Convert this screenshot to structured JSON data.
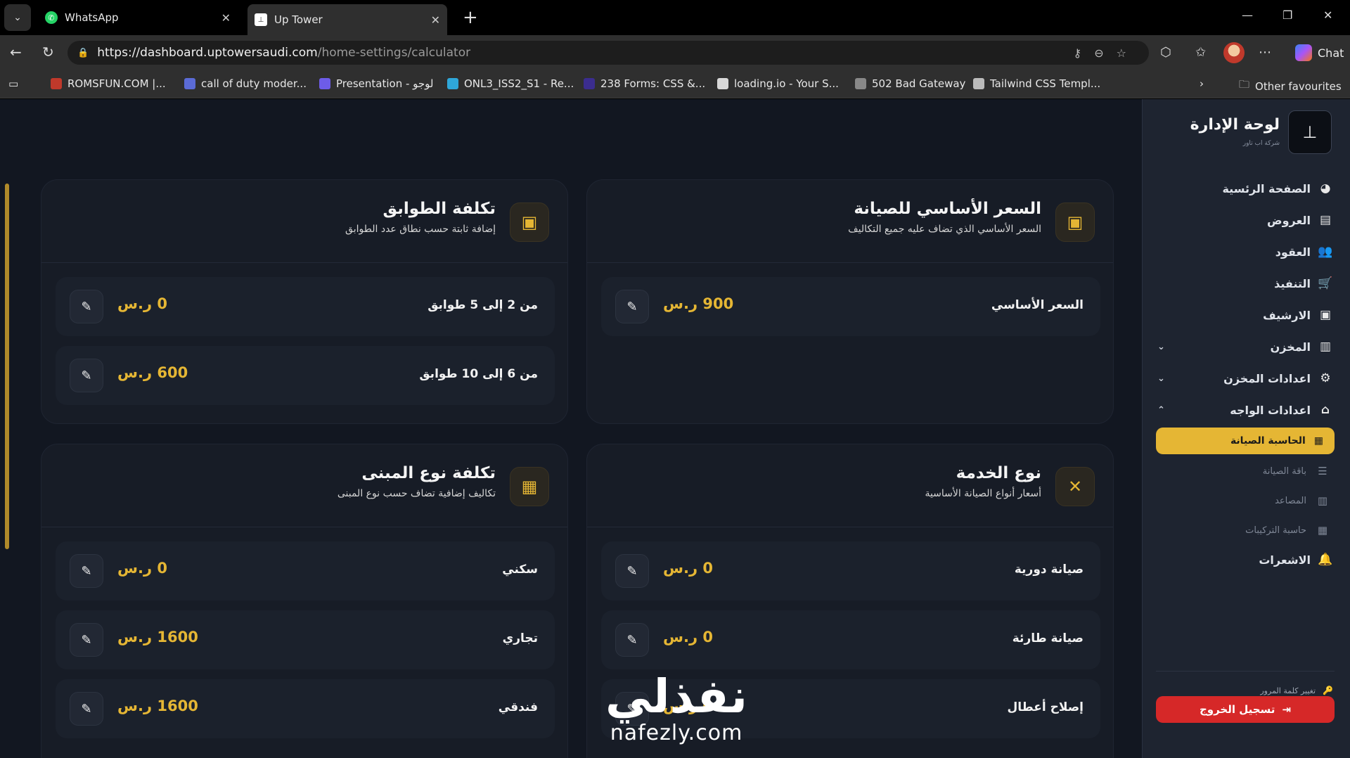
{
  "browser": {
    "tabs": [
      {
        "title": "WhatsApp",
        "icon": "whatsapp-icon"
      },
      {
        "title": "Up Tower",
        "icon": "uptower-favicon"
      }
    ],
    "url_host": "https://dashboard.uptowersaudi.com",
    "url_path": "/home-settings/calculator",
    "chat_label": "Chat",
    "bookmarks": [
      {
        "label": "ROMSFUN.COM |..."
      },
      {
        "label": "call of duty moder..."
      },
      {
        "label": "Presentation - لوجو"
      },
      {
        "label": "ONL3_ISS2_S1 - Re..."
      },
      {
        "label": "238 Forms: CSS &..."
      },
      {
        "label": "loading.io - Your S..."
      },
      {
        "label": "502 Bad Gateway"
      },
      {
        "label": "Tailwind CSS Templ..."
      }
    ],
    "other_favourites": "Other favourites"
  },
  "sidebar": {
    "brand_title": "لوحة الإدارة",
    "brand_sub": "شركة اب تاور",
    "nav": [
      {
        "label": "الصفحة الرئسية",
        "icon": "pie-chart-icon"
      },
      {
        "label": "العروض",
        "icon": "offers-icon"
      },
      {
        "label": "العقود",
        "icon": "users-icon"
      },
      {
        "label": "التنفيذ",
        "icon": "cart-icon"
      },
      {
        "label": "الارشيف",
        "icon": "archive-icon"
      },
      {
        "label": "المخزن",
        "icon": "warehouse-icon"
      },
      {
        "label": "اعدادات المخزن",
        "icon": "gear-icon"
      },
      {
        "label": "اعدادات الواجه",
        "icon": "home-icon"
      }
    ],
    "active": "الحاسبة الصيانة",
    "sub": [
      {
        "label": "باقة الصيانة",
        "icon": "list-icon"
      },
      {
        "label": "المصاعد",
        "icon": "building-icon"
      },
      {
        "label": "حاسبة التركيبات",
        "icon": "calculator-icon"
      }
    ],
    "notifications": "الاشعرات",
    "change_password": "تغيير كلمة المرور",
    "logout": "تسجيل الخروج"
  },
  "cards": {
    "base_price": {
      "title": "السعر الأساسي للصيانة",
      "subtitle": "السعر الأساسي الذي تضاف عليه جميع التكاليف",
      "rows": [
        {
          "label": "السعر الأساسي",
          "value": "900 ر.س"
        }
      ]
    },
    "floors": {
      "title": "تكلفة الطوابق",
      "subtitle": "إضافة ثابتة حسب نطاق عدد الطوابق",
      "rows": [
        {
          "label": "من 2 إلى 5 طوابق",
          "value": "0 ر.س"
        },
        {
          "label": "من 6 إلى 10 طوابق",
          "value": "600 ر.س"
        }
      ]
    },
    "service_type": {
      "title": "نوع الخدمة",
      "subtitle": "أسعار أنواع الصيانة الأساسية",
      "rows": [
        {
          "label": "صيانة دورية",
          "value": "0 ر.س"
        },
        {
          "label": "صيانة طارئة",
          "value": "0 ر.س"
        },
        {
          "label": "إصلاح أعطال",
          "value": "0 ر.س"
        }
      ]
    },
    "building_type": {
      "title": "تكلفة نوع المبنى",
      "subtitle": "تكاليف إضافية تضاف حسب نوع المبنى",
      "rows": [
        {
          "label": "سكني",
          "value": "0 ر.س"
        },
        {
          "label": "تجاري",
          "value": "1600 ر.س"
        },
        {
          "label": "فندقي",
          "value": "1600 ر.س"
        }
      ]
    }
  },
  "watermark": {
    "arabic": "نفذلي",
    "latin": "nafezly.com"
  },
  "colors": {
    "accent": "#e5b634",
    "danger": "#d62828",
    "bg": "#121721",
    "sidebar": "#1e2430"
  }
}
